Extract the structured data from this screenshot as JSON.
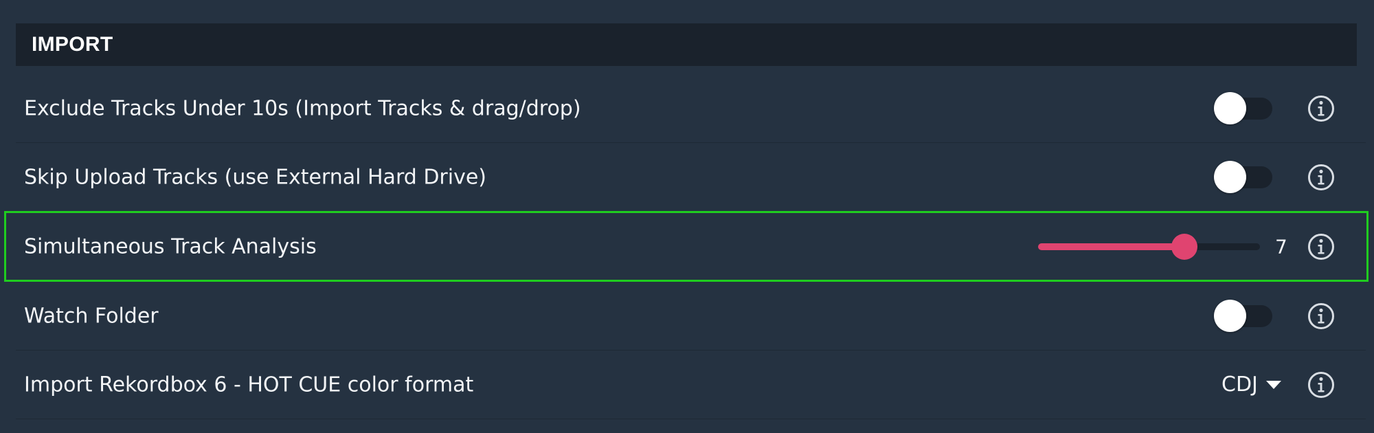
{
  "section": {
    "title": "IMPORT"
  },
  "rows": [
    {
      "label": "Exclude Tracks Under 10s (Import Tracks & drag/drop)",
      "control": "toggle",
      "enabled": false
    },
    {
      "label": "Skip Upload Tracks (use External Hard Drive)",
      "control": "toggle",
      "enabled": false
    },
    {
      "label": "Simultaneous Track Analysis",
      "control": "slider",
      "value": "7",
      "fill_fraction": 0.66,
      "highlighted": true
    },
    {
      "label": "Watch Folder",
      "control": "toggle",
      "enabled": false
    },
    {
      "label": "Import Rekordbox 6 - HOT CUE color format",
      "control": "dropdown",
      "selected": "CDJ"
    }
  ],
  "icons": {
    "info": "info-icon",
    "dropdown": "caret-down-icon"
  },
  "colors": {
    "background": "#253241",
    "header_background": "#1a222c",
    "accent": "#e04470",
    "highlight_border": "#1fcc1f",
    "toggle_knob": "#ffffff"
  }
}
